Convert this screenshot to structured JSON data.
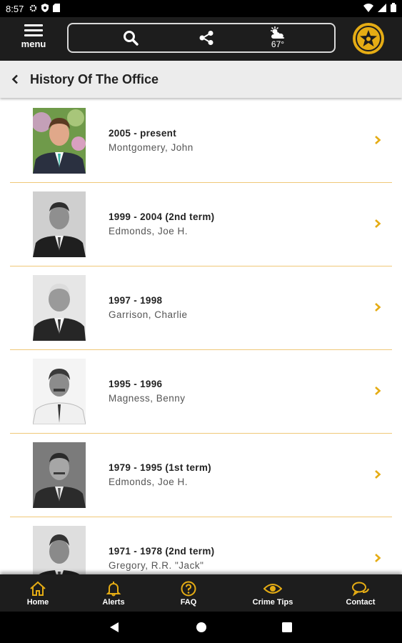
{
  "status_bar": {
    "time": "8:57"
  },
  "topbar": {
    "menu_label": "menu",
    "weather_temp": "67°",
    "accent": "#e5ac14"
  },
  "header": {
    "title": "History Of The Office"
  },
  "officers": [
    {
      "term": "2005 - present",
      "name": "Montgomery,  John"
    },
    {
      "term": "1999 - 2004 (2nd term)",
      "name": "Edmonds,  Joe  H."
    },
    {
      "term": "1997 - 1998",
      "name": "Garrison,  Charlie"
    },
    {
      "term": "1995 - 1996",
      "name": "Magness,  Benny"
    },
    {
      "term": "1979 - 1995 (1st term)",
      "name": "Edmonds,  Joe  H."
    },
    {
      "term": "1971 - 1978 (2nd term)",
      "name": "Gregory,  R.R. \"Jack\""
    }
  ],
  "bottom_nav": [
    {
      "label": "Home",
      "icon": "home-icon"
    },
    {
      "label": "Alerts",
      "icon": "bell-icon"
    },
    {
      "label": "FAQ",
      "icon": "question-icon"
    },
    {
      "label": "Crime Tips",
      "icon": "eye-icon"
    },
    {
      "label": "Contact",
      "icon": "chat-icon"
    }
  ]
}
